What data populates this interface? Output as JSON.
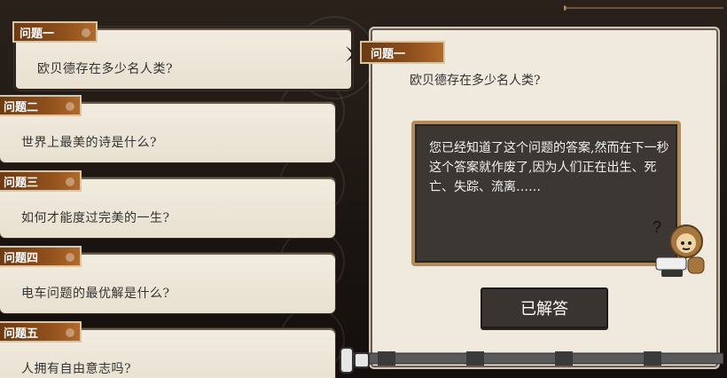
{
  "questions": [
    {
      "label": "问题一",
      "text": "欧贝德存在多少名人类?",
      "active": true
    },
    {
      "label": "问题二",
      "text": "世界上最美的诗是什么?"
    },
    {
      "label": "问题三",
      "text": "如何才能度过完美的一生?"
    },
    {
      "label": "问题四",
      "text": "电车问题的最优解是什么?"
    },
    {
      "label": "问题五",
      "text": "人拥有自由意志吗?"
    }
  ],
  "detail": {
    "label": "问题一",
    "text": "欧贝德存在多少名人类?",
    "answer": "您已经知道了这个问题的答案,然而在下一秒这个答案就作废了,因为人们正在出生、死亡、失踪、流离……",
    "button": "已解答"
  },
  "colors": {
    "tag": "#8e4f1b",
    "card_bg": "#efe9de",
    "answer_bg": "#3d3733"
  },
  "icons": {
    "arrow": "chevron-right-icon",
    "mascot": "monkey-typewriter-icon"
  }
}
